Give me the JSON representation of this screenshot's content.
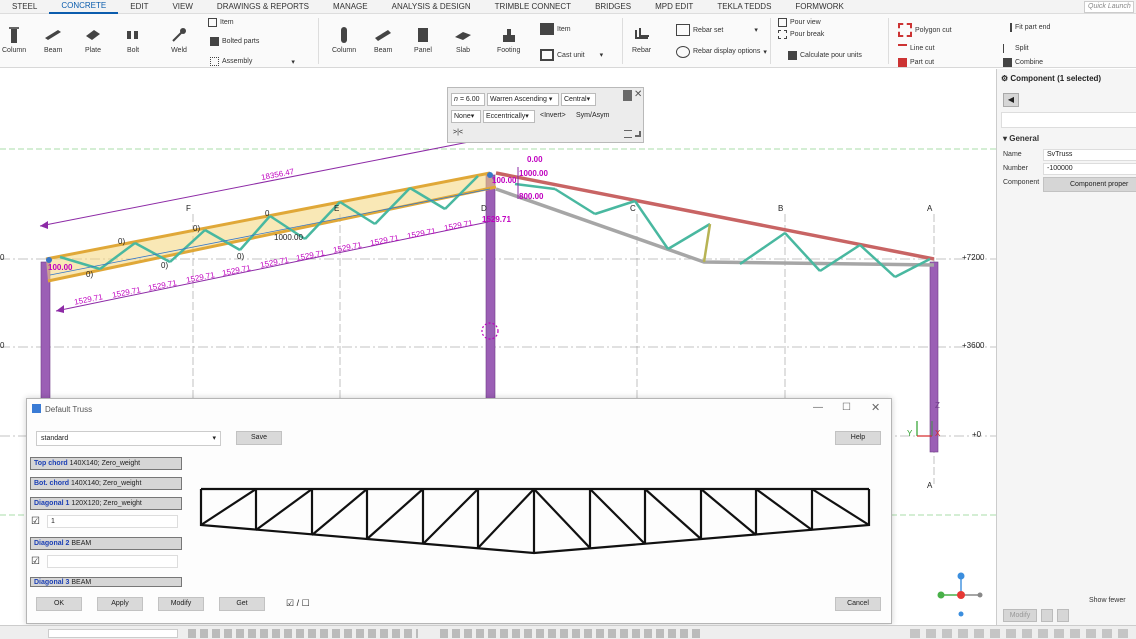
{
  "menu": {
    "items": [
      "STEEL",
      "CONCRETE",
      "EDIT",
      "VIEW",
      "DRAWINGS & REPORTS",
      "MANAGE",
      "ANALYSIS & DESIGN",
      "TRIMBLE CONNECT",
      "BRIDGES",
      "MPD EDIT",
      "TEKLA TEDDS",
      "FORMWORK"
    ],
    "active": "CONCRETE",
    "quick_launch_placeholder": "Quick Launch"
  },
  "ribbon": {
    "steel": {
      "column": "Column",
      "beam": "Beam",
      "plate": "Plate",
      "bolt": "Bolt",
      "weld": "Weld",
      "item": "Item",
      "bolted_parts": "Bolted parts",
      "assembly": "Assembly"
    },
    "concrete": {
      "column": "Column",
      "beam": "Beam",
      "panel": "Panel",
      "slab": "Slab",
      "footing": "Footing",
      "item": "Item",
      "cast_unit": "Cast unit"
    },
    "rebar": {
      "rebar": "Rebar",
      "rebar_set": "Rebar set",
      "rebar_display": "Rebar display options"
    },
    "pour": {
      "pour_view": "Pour view",
      "pour_break": "Pour break",
      "calc_pour": "Calculate pour units"
    },
    "edit": {
      "polygon_cut": "Polygon cut",
      "line_cut": "Line cut",
      "part_cut": "Part cut",
      "fit_part_end": "Fit part end",
      "split": "Split",
      "combine": "Combine"
    }
  },
  "toolbar_mini": {
    "n_label": "n =",
    "n_value": "6.00",
    "type_value": "Warren Ascending",
    "position_value": "Central",
    "end_value": "None",
    "ecc_value": "Eccentrically",
    "invert_label": "<Invert>",
    "sym_label": "Sym/Asym",
    "extra_label": ">|<"
  },
  "model": {
    "grid_labels": [
      "F",
      "E",
      "D",
      "C",
      "B",
      "A",
      "A"
    ],
    "levels": [
      "+7200",
      "+3600",
      "+0"
    ],
    "dims": {
      "main": "18356.47",
      "zero": "0.00",
      "d1000": "1000.00",
      "d100": "100.00",
      "d800": "800.00",
      "d1000b": "1000.00",
      "d100b": "100.00",
      "d1529": "1529.71",
      "seg": "1529.71",
      "small_zero": "0",
      "small_o": "0)"
    },
    "axis_labels": {
      "x": "X",
      "y": "Y",
      "z": "Z"
    }
  },
  "right_panel": {
    "title": "Component (1 selected)",
    "section_general": "General",
    "name_label": "Name",
    "name_value": "SvTruss",
    "number_label": "Number",
    "number_value": "-100000",
    "component_label": "Component",
    "component_button": "Component proper",
    "show_fewer": "Show fewer",
    "modify_button": "Modify"
  },
  "truss_dialog": {
    "title": "Default Truss",
    "preset": "standard",
    "save": "Save",
    "help": "Help",
    "rows": [
      {
        "name": "Top chord",
        "value": "140X140; Zero_weight"
      },
      {
        "name": "Bot. chord",
        "value": "140X140; Zero_weight"
      },
      {
        "name": "Diagonal 1",
        "value": "120X120; Zero_weight"
      },
      {
        "name": "Diagonal 2",
        "value": "BEAM"
      },
      {
        "name": "Diagonal 3",
        "value": "BEAM"
      }
    ],
    "diag1_input": "1",
    "buttons": {
      "ok": "OK",
      "apply": "Apply",
      "modify": "Modify",
      "get": "Get",
      "cancel": "Cancel",
      "check_toggle": "☑ / ☐"
    }
  },
  "colors": {
    "accent": "#0b5cad",
    "dim_magenta": "#c000c0",
    "column_purple": "#9b5fb5",
    "truss_green": "#49b8a0",
    "truss_yellow": "#e8c23a",
    "roof_red": "#c86464",
    "grid_line": "#999999",
    "level_green": "#8fd18f"
  }
}
